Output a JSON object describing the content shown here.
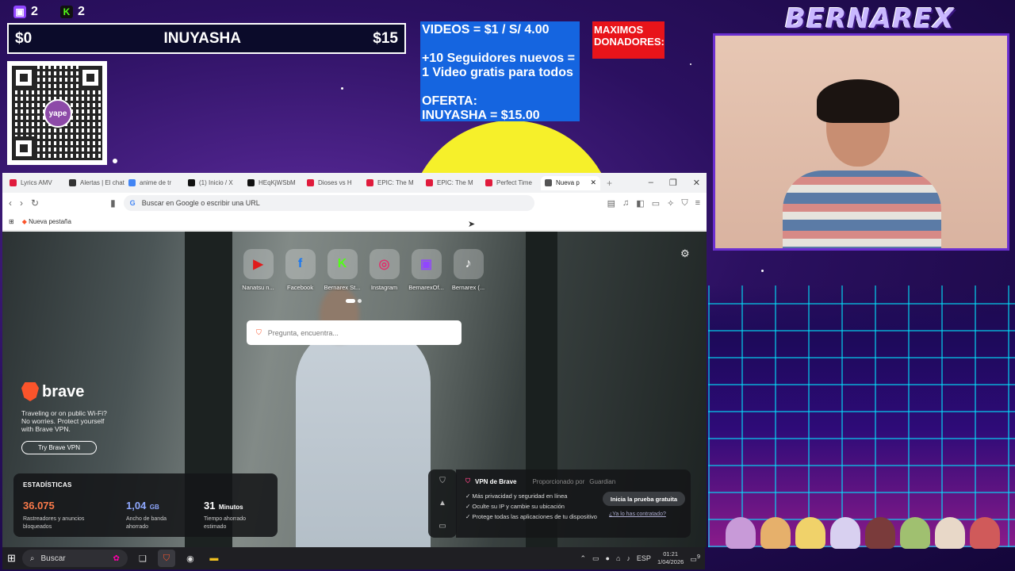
{
  "overlay": {
    "twitch_count": "2",
    "kick_count": "2",
    "goal": {
      "start": "$0",
      "title": "INUYASHA",
      "end": "$15"
    },
    "qr_logo": "yape",
    "promo_lines": [
      "VIDEOS = $1 / S/ 4.00",
      "",
      "+10 Seguidores nuevos =",
      "1 Video gratis para todos",
      "",
      "OFERTA:",
      "INUYASHA = $15.00"
    ],
    "donors_title": "MAXIMOS DONADORES:",
    "streamer_name": "BERNAREX",
    "colors": {
      "promo_bg": "#1565e0",
      "donors_bg": "#e8141a",
      "sun": "#f6f02a",
      "webcam_border": "#6b2fd0"
    }
  },
  "browser": {
    "tabs": [
      {
        "label": "Lyrics AMV",
        "color": "#e01b3c"
      },
      {
        "label": "Alertas | El chat",
        "color": "#333"
      },
      {
        "label": "anime de tr",
        "color": "#4285f4"
      },
      {
        "label": "(1) Inicio / X",
        "color": "#111"
      },
      {
        "label": "HEqKjWSbM",
        "color": "#111"
      },
      {
        "label": "Dioses vs H",
        "color": "#e01b3c"
      },
      {
        "label": "EPIC: The M",
        "color": "#e01b3c"
      },
      {
        "label": "EPIC: The M",
        "color": "#e01b3c"
      },
      {
        "label": "Perfect Time",
        "color": "#e01b3c"
      },
      {
        "label": "Nueva p",
        "color": "#555"
      }
    ],
    "url_placeholder": "Buscar en Google o escribir una URL",
    "bookmark": "Nueva pestaña",
    "shortcuts": [
      {
        "label": "Nanatsu n...",
        "icon": "youtube-icon",
        "glyph": "▶",
        "color": "#e01b1b"
      },
      {
        "label": "Facebook",
        "icon": "facebook-icon",
        "glyph": "f",
        "color": "#1877f2"
      },
      {
        "label": "Bernarex St...",
        "icon": "kick-icon",
        "glyph": "K",
        "color": "#53fc18"
      },
      {
        "label": "Instagram",
        "icon": "instagram-icon",
        "glyph": "◎",
        "color": "#e1306c"
      },
      {
        "label": "BernarexOf...",
        "icon": "twitch-icon",
        "glyph": "▣",
        "color": "#9146ff"
      },
      {
        "label": "Bernarex (...",
        "icon": "tiktok-icon",
        "glyph": "♪",
        "color": "#111"
      }
    ],
    "search_placeholder": "Pregunta, encuentra...",
    "brave": {
      "logo": "brave",
      "promo": "Traveling or on public Wi-Fi? No worries. Protect yourself with Brave VPN.",
      "cta": "Try Brave VPN"
    },
    "stats": {
      "title": "ESTADÍSTICAS",
      "items": [
        {
          "value": "36.075",
          "unit": "",
          "label": "Rastreadores y anuncios bloqueados",
          "color": "#fb7a4a"
        },
        {
          "value": "1,04",
          "unit": "GB",
          "label": "Ancho de banda ahorrado",
          "color": "#8fa8ff"
        },
        {
          "value": "31",
          "unit": "Minutos",
          "label": "Tiempo ahorrado estimado",
          "color": "#ffffff"
        }
      ]
    },
    "vpn": {
      "title": "VPN de Brave",
      "provider": "Proporcionado por",
      "provider_name": "Guardian",
      "features": [
        "Más privacidad y seguridad en línea",
        "Oculte su IP y cambie su ubicación",
        "Protege todas las aplicaciones de tu dispositivo"
      ],
      "cta": "Inicia la prueba gratuita",
      "link": "¿Ya lo has contratado?"
    }
  },
  "taskbar": {
    "search": "Buscar",
    "language": "ESP",
    "time": "01:21",
    "date": "1/04/2026",
    "notification_count": "9"
  }
}
